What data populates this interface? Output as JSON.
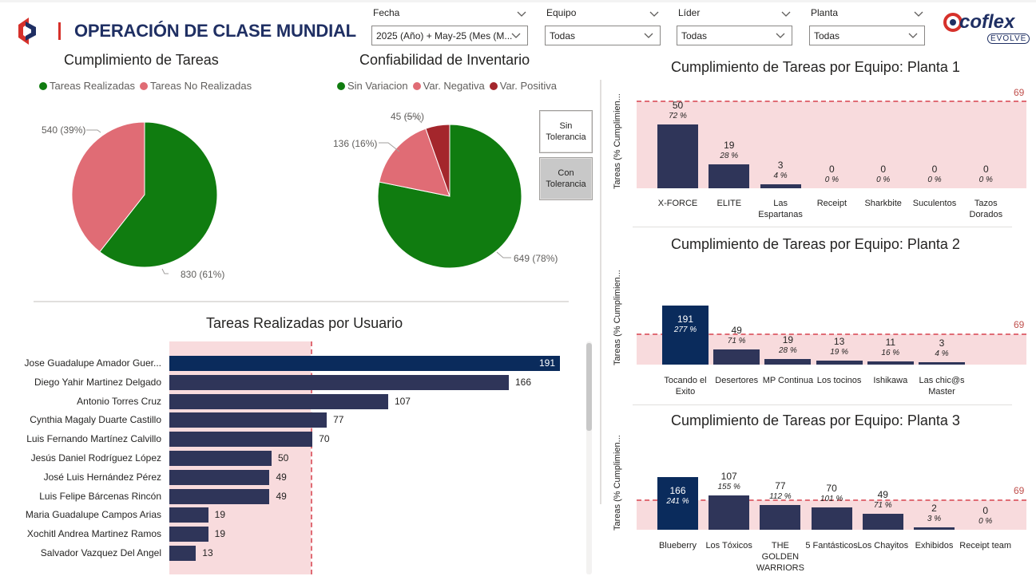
{
  "header": {
    "title": "OPERACIÓN DE CLASE MUNDIAL",
    "logo_text": "coflex",
    "logo_sub": "EVOLVE"
  },
  "slicers": [
    {
      "label": "Fecha",
      "value": "2025 (Año) + May-25 (Mes (M..."
    },
    {
      "label": "Equipo",
      "value": "Todas"
    },
    {
      "label": "Líder",
      "value": "Todas"
    },
    {
      "label": "Planta",
      "value": "Todas"
    }
  ],
  "cumplimiento": {
    "title": "Cumplimiento de Tareas",
    "legend": [
      {
        "name": "Tareas Realizadas",
        "color": "#107c10"
      },
      {
        "name": "Tareas No Realizadas",
        "color": "#e06c75"
      }
    ],
    "labels": [
      "540 (39%)",
      "830 (61%)"
    ]
  },
  "confiabilidad": {
    "title": "Confiabilidad de Inventario",
    "legend": [
      {
        "name": "Sin Variacion",
        "color": "#107c10"
      },
      {
        "name": "Var. Negativa",
        "color": "#e06c75"
      },
      {
        "name": "Var. Positiva",
        "color": "#a4262c"
      }
    ],
    "labels": [
      "45 (5%)",
      "136 (16%)",
      "649 (78%)"
    ],
    "buttons": [
      {
        "label": "Sin Tolerancia",
        "active": false
      },
      {
        "label": "Con Tolerancia",
        "active": true
      }
    ]
  },
  "usuarios": {
    "title": "Tareas Realizadas por Usuario"
  },
  "planta_titles": {
    "p1": "Cumplimiento de Tareas por Equipo: Planta 1",
    "p2": "Cumplimiento de Tareas por Equipo: Planta 2",
    "p3": "Cumplimiento de Tareas por Equipo: Planta 3",
    "yaxis": "Tareas (% Cumplimien...",
    "ref": "69"
  },
  "chart_data": [
    {
      "type": "pie",
      "title": "Cumplimiento de Tareas",
      "series": [
        {
          "name": "Tareas Realizadas",
          "value": 830,
          "percent": 61,
          "color": "#107c10"
        },
        {
          "name": "Tareas No Realizadas",
          "value": 540,
          "percent": 39,
          "color": "#e06c75"
        }
      ]
    },
    {
      "type": "pie",
      "title": "Confiabilidad de Inventario",
      "series": [
        {
          "name": "Sin Variacion",
          "value": 649,
          "percent": 78,
          "color": "#107c10"
        },
        {
          "name": "Var. Negativa",
          "value": 136,
          "percent": 16,
          "color": "#e06c75"
        },
        {
          "name": "Var. Positiva",
          "value": 45,
          "percent": 5,
          "color": "#a4262c"
        }
      ]
    },
    {
      "type": "bar",
      "title": "Tareas Realizadas por Usuario",
      "categories": [
        "Jose Guadalupe Amador Guer...",
        "Diego Yahir Martinez Delgado",
        "Antonio Torres Cruz",
        "Cynthia Magaly Duarte Castillo",
        "Luis Fernando Martínez Calvillo",
        "Jesús Daniel Rodríguez López",
        "José Luis Hernández Pérez",
        "Luis Felipe Bárcenas Rincón",
        "Maria Guadalupe Campos Arias",
        "Xochitl Andrea Martinez Ramos",
        "Salvador Vazquez Del Angel"
      ],
      "values": [
        191,
        166,
        107,
        77,
        70,
        50,
        49,
        49,
        19,
        19,
        13
      ],
      "highlight": [
        true,
        false,
        false,
        false,
        false,
        false,
        false,
        false,
        false,
        false,
        false
      ],
      "reference": 69
    },
    {
      "type": "bar",
      "title": "Cumplimiento de Tareas por Equipo: Planta 1",
      "categories": [
        "X-FORCE",
        "ELITE",
        "Las Espartanas",
        "Receipt",
        "Sharkbite",
        "Suculentos",
        "Tazos Dorados"
      ],
      "values": [
        50,
        19,
        3,
        0,
        0,
        0,
        0
      ],
      "percents": [
        "72 %",
        "28 %",
        "4 %",
        "0 %",
        "0 %",
        "0 %",
        "0 %"
      ],
      "highlight": [
        false,
        false,
        false,
        false,
        false,
        false,
        false
      ],
      "reference": 69
    },
    {
      "type": "bar",
      "title": "Cumplimiento de Tareas por Equipo: Planta 2",
      "categories": [
        "Tocando el Exito",
        "Desertores",
        "MP Continua",
        "Los tocinos",
        "Ishikawa",
        "Las chic@s Master"
      ],
      "values": [
        191,
        49,
        19,
        13,
        11,
        3
      ],
      "percents": [
        "277 %",
        "71 %",
        "28 %",
        "19 %",
        "16 %",
        "4 %"
      ],
      "highlight": [
        true,
        false,
        false,
        false,
        false,
        false
      ],
      "reference": 69
    },
    {
      "type": "bar",
      "title": "Cumplimiento de Tareas por Equipo: Planta 3",
      "categories": [
        "Blueberry",
        "Los Tóxicos",
        "THE GOLDEN WARRIORS",
        "5 Fantásticos",
        "Los Chayitos",
        "Exhibidos",
        "Receipt team"
      ],
      "values": [
        166,
        107,
        77,
        70,
        49,
        2,
        0
      ],
      "percents": [
        "241 %",
        "155 %",
        "112 %",
        "101 %",
        "71 %",
        "3 %",
        "0 %"
      ],
      "highlight": [
        true,
        false,
        false,
        false,
        false,
        false,
        false
      ],
      "reference": 69
    }
  ]
}
